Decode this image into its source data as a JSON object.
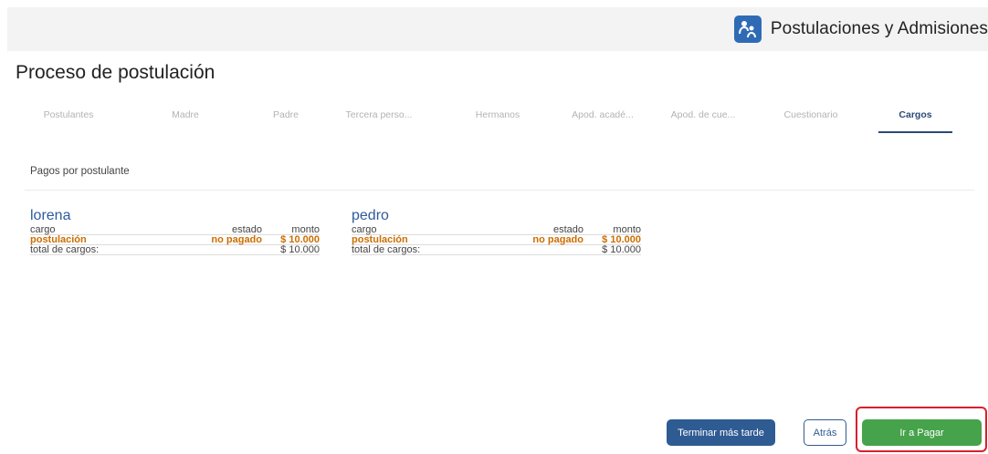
{
  "header": {
    "app_title": "Postulaciones y Admisiones",
    "logo_icon": "family-icon"
  },
  "page": {
    "title": "Proceso de postulación"
  },
  "tabs": [
    {
      "label": "Postulantes",
      "active": false
    },
    {
      "label": "Madre",
      "active": false
    },
    {
      "label": "Padre",
      "active": false
    },
    {
      "label": "Tercera perso...",
      "active": false
    },
    {
      "label": "Hermanos",
      "active": false
    },
    {
      "label": "Apod. acadé...",
      "active": false
    },
    {
      "label": "Apod. de cue...",
      "active": false
    },
    {
      "label": "Cuestionario",
      "active": false
    },
    {
      "label": "Cargos",
      "active": true
    }
  ],
  "section": {
    "label": "Pagos por postulante"
  },
  "applicants": [
    {
      "name": "lorena",
      "headers": {
        "cargo": "cargo",
        "estado": "estado",
        "monto": "monto"
      },
      "items": [
        {
          "cargo": "postulación",
          "estado": "no pagado",
          "monto": "$ 10.000"
        }
      ],
      "total_label": "total de cargos:",
      "total_amount": "$ 10.000"
    },
    {
      "name": "pedro",
      "headers": {
        "cargo": "cargo",
        "estado": "estado",
        "monto": "monto"
      },
      "items": [
        {
          "cargo": "postulación",
          "estado": "no pagado",
          "monto": "$ 10.000"
        }
      ],
      "total_label": "total de cargos:",
      "total_amount": "$ 10.000"
    }
  ],
  "actions": {
    "later_label": "Terminar más tarde",
    "back_label": "Atrás",
    "pay_label": "Ir a Pagar"
  },
  "colors": {
    "brand_blue": "#2f5b93",
    "accent_orange": "#cc6e00",
    "pay_green": "#46a34b",
    "highlight_red": "#d9202c"
  }
}
